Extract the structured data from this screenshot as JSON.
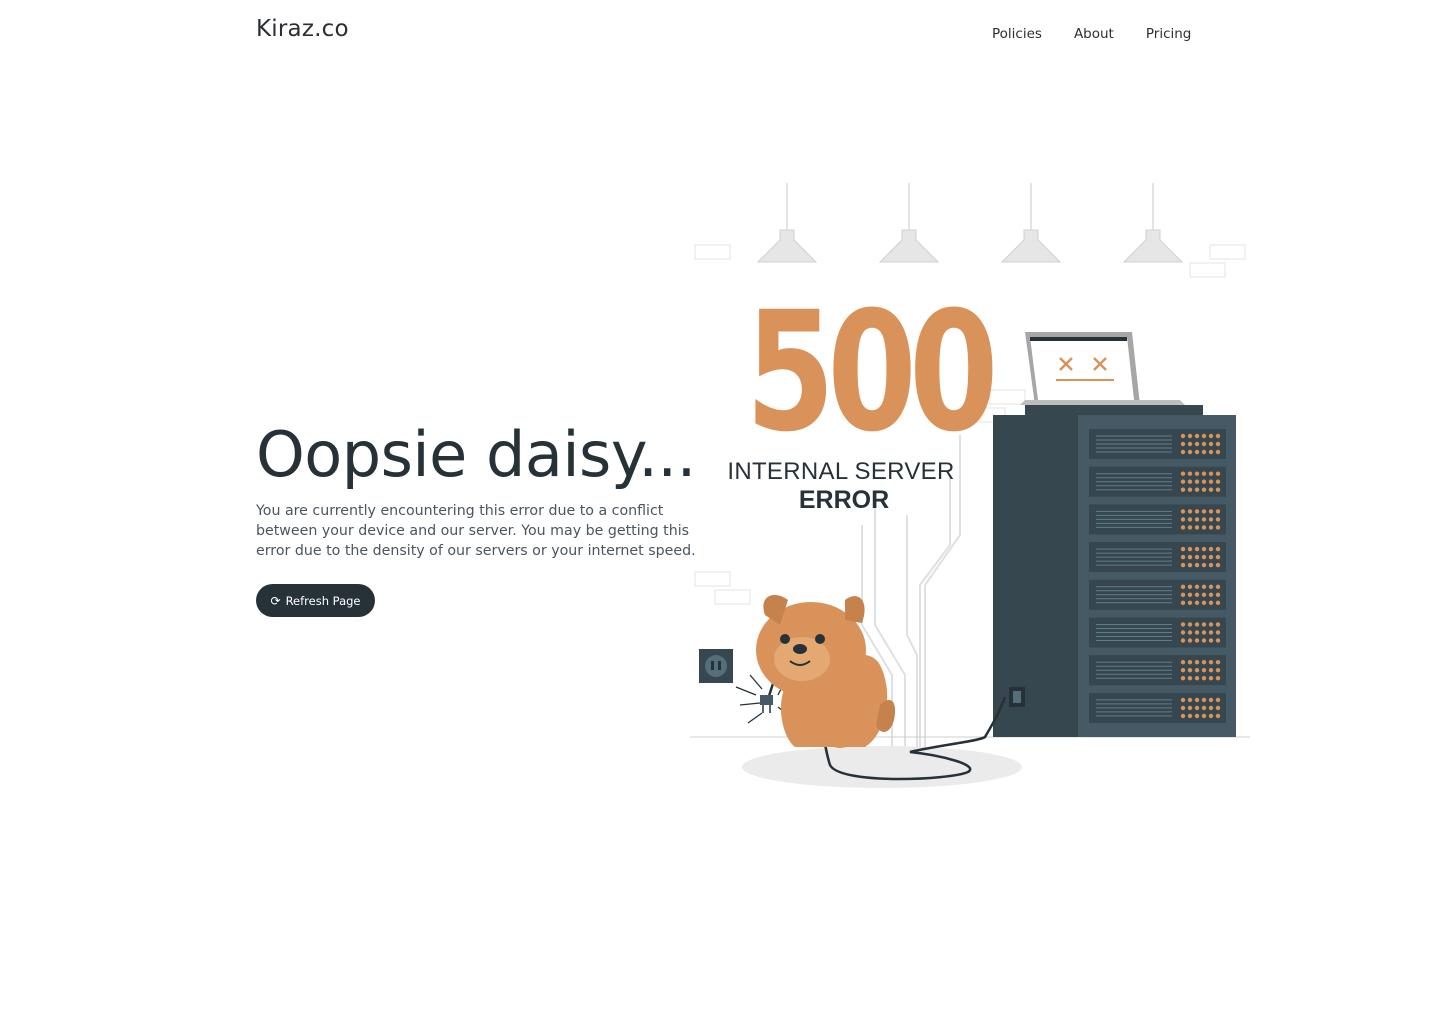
{
  "header": {
    "logo": "Kiraz.co",
    "nav": [
      "Policies",
      "About",
      "Pricing"
    ]
  },
  "main": {
    "headline": "Oopsie daisy...",
    "description": "You are currently encountering this error due to a conflict between your device and our server. You may be getting this error due to the density of our servers or your internet speed.",
    "refresh_label": "Refresh Page",
    "refresh_icon": "refresh-icon"
  },
  "illustration": {
    "code": "500",
    "line1": "INTERNAL SERVER",
    "line2": "ERROR"
  },
  "colors": {
    "primary": "#263238",
    "accent": "#d9935a",
    "server_front": "#455a64",
    "server_side": "#37474f"
  }
}
